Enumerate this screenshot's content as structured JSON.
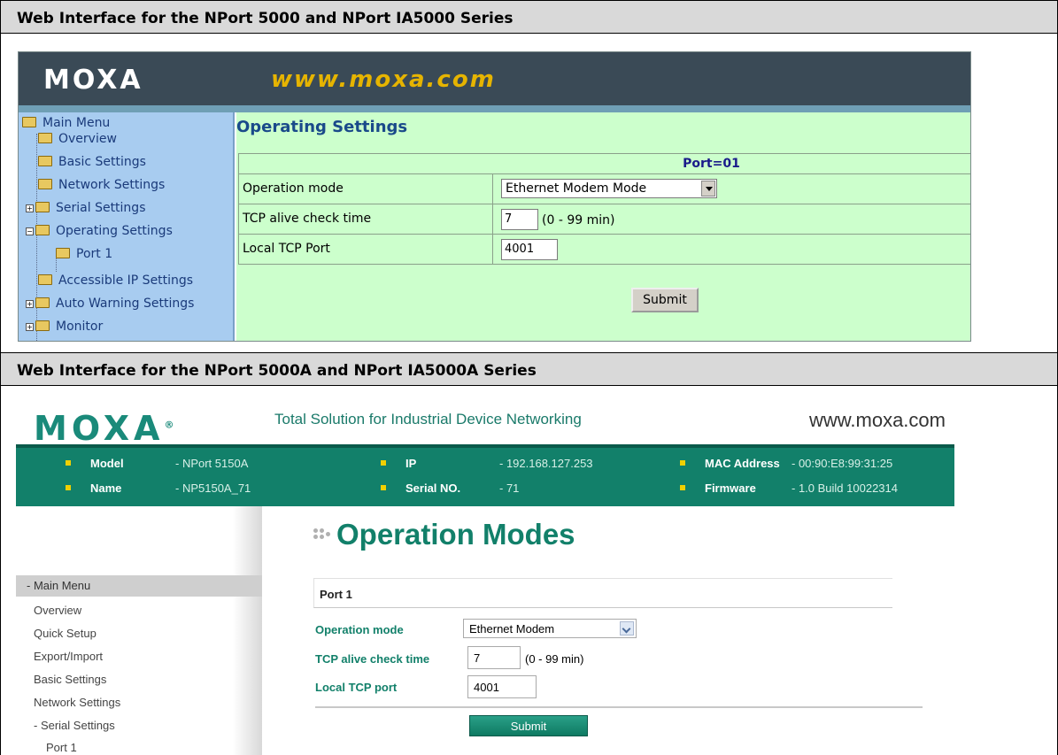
{
  "sections": {
    "legacy_title": "Web Interface for the NPort 5000 and NPort IA5000 Series",
    "new_title": "Web Interface for the NPort 5000A and NPort IA5000A Series"
  },
  "legacy": {
    "logo": "MOXA",
    "url": "www.moxa.com",
    "menu": {
      "root": "Main Menu",
      "items": [
        "Overview",
        "Basic Settings",
        "Network Settings",
        "Serial Settings",
        "Operating Settings",
        "Port 1",
        "Accessible IP Settings",
        "Auto Warning Settings",
        "Monitor"
      ]
    },
    "page_title": "Operating Settings",
    "port_header": "Port=01",
    "fields": {
      "operation_mode_label": "Operation mode",
      "operation_mode_value": "Ethernet Modem Mode",
      "tcp_alive_label": "TCP alive check time",
      "tcp_alive_value": "7",
      "tcp_alive_hint": "(0 - 99 min)",
      "local_port_label": "Local TCP Port",
      "local_port_value": "4001"
    },
    "submit": "Submit"
  },
  "modern": {
    "logo": "MOXA",
    "logo_mark": "®",
    "tagline": "Total Solution for Industrial Device Networking",
    "url": "www.moxa.com",
    "info": {
      "model_key": "Model",
      "model_val": "- NPort 5150A",
      "name_key": "Name",
      "name_val": "- NP5150A_71",
      "ip_key": "IP",
      "ip_val": "- 192.168.127.253",
      "serial_key": "Serial NO.",
      "serial_val": "- 71",
      "mac_key": "MAC Address",
      "mac_val": "- 00:90:E8:99:31:25",
      "fw_key": "Firmware",
      "fw_val": "- 1.0 Build 10022314"
    },
    "menu": {
      "root": "- Main Menu",
      "items": [
        "Overview",
        "Quick Setup",
        "Export/Import",
        "Basic Settings",
        "Network Settings",
        "- Serial Settings",
        "Port 1"
      ]
    },
    "page_title": "Operation Modes",
    "port_header": "Port 1",
    "fields": {
      "operation_mode_label": "Operation mode",
      "operation_mode_value": "Ethernet Modem",
      "tcp_alive_label": "TCP alive check time",
      "tcp_alive_value": "7",
      "tcp_alive_hint": "(0 - 99 min)",
      "local_port_label": "Local TCP port",
      "local_port_value": "4001"
    },
    "submit": "Submit"
  },
  "colors": {
    "legacy_sidebar": "#a8ccf0",
    "legacy_content": "#ccffcc",
    "legacy_banner": "#3a4a56",
    "legacy_url": "#e6b400",
    "modern_accent": "#12806a"
  }
}
